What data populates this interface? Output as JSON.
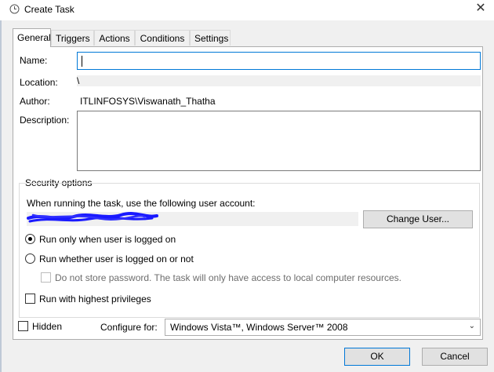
{
  "window": {
    "title": "Create Task"
  },
  "tabs": [
    {
      "label": "General",
      "active": true
    },
    {
      "label": "Triggers",
      "active": false
    },
    {
      "label": "Actions",
      "active": false
    },
    {
      "label": "Conditions",
      "active": false
    },
    {
      "label": "Settings",
      "active": false
    }
  ],
  "general": {
    "name_label": "Name:",
    "name_value": "",
    "location_label": "Location:",
    "location_value": "\\",
    "author_label": "Author:",
    "author_value": "ITLINFOSYS\\Viswanath_Thatha",
    "description_label": "Description:",
    "description_value": ""
  },
  "security": {
    "group_title": "Security options",
    "account_prompt": "When running the task, use the following user account:",
    "change_user_label": "Change User...",
    "run_logged_on_label": "Run only when user is logged on",
    "run_logged_on_selected": true,
    "run_whether_label": "Run whether user is logged on or not",
    "run_whether_selected": false,
    "no_store_password_label": "Do not store password.  The task will only have access to local computer resources.",
    "no_store_password_checked": false,
    "highest_privileges_label": "Run with highest privileges",
    "highest_privileges_checked": false
  },
  "bottom": {
    "hidden_label": "Hidden",
    "hidden_checked": false,
    "configure_label": "Configure for:",
    "configure_value": "Windows Vista™, Windows Server™ 2008"
  },
  "buttons": {
    "ok_label": "OK",
    "cancel_label": "Cancel"
  },
  "colors": {
    "accent": "#0078d7",
    "scribble": "#1a1aff"
  }
}
